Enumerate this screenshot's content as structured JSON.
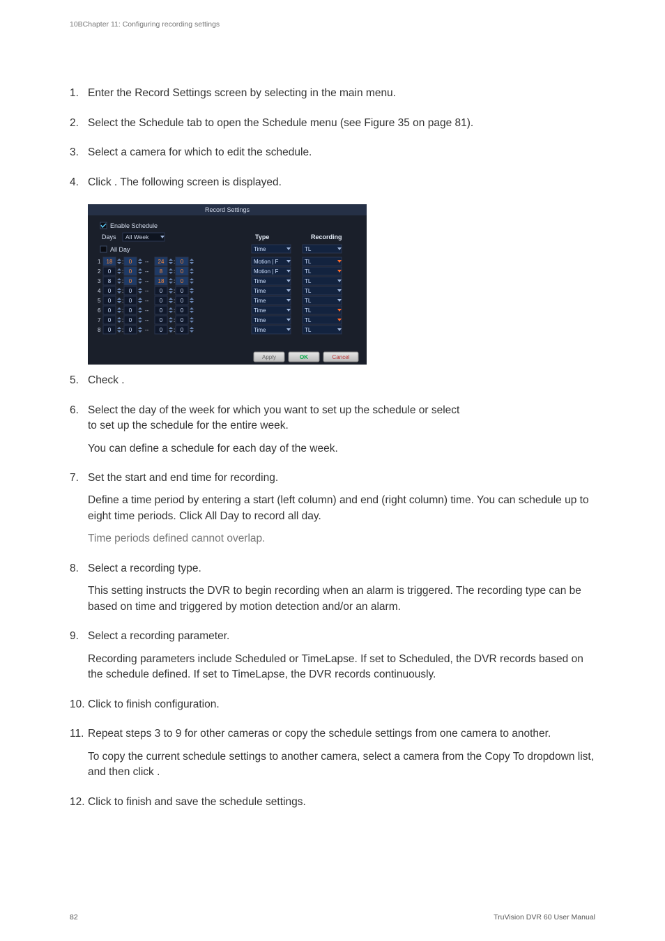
{
  "running_head": "10BChapter 11: Configuring recording settings",
  "steps": {
    "s1": "Enter the Record Settings screen by selecting            in the main menu.",
    "s2": "Select the Schedule tab to open the Schedule menu (see Figure 35 on page 81).",
    "s3": "Select a camera for which to edit the schedule.",
    "s4": "Click      . The following screen is displayed.",
    "s5": "Check                                     .",
    "s6a": "Select the day of the week for which you want to set up the schedule or select",
    "s6b": "                           to set up the schedule for the entire week.",
    "s6c": "You can define a schedule for each day of the week.",
    "s7a": "Set the start and end time for recording.",
    "s7b": "Define a time period by entering a start (left column) and end (right column) time. You can schedule up to eight time periods. Click All Day to record all day.",
    "s7note": "           Time periods defined cannot overlap.",
    "s8a": "Select a recording type.",
    "s8b": "This setting instructs the DVR to begin recording when an alarm is triggered. The recording type can be based on time and triggered by motion detection and/or an alarm.",
    "s9a": "Select a recording parameter.",
    "s9b": "Recording parameters include Scheduled or TimeLapse. If set to Scheduled, the DVR records based on the schedule defined. If set to TimeLapse, the DVR records continuously.",
    "s10": "Click       to finish configuration.",
    "s11a": "Repeat steps 3 to 9 for other cameras or copy the schedule settings from one camera to another.",
    "s11b": "To copy the current schedule settings to another camera, select a camera from the Copy To dropdown list, and then click         .",
    "s12": "Click       to finish and save the schedule settings."
  },
  "screenshot": {
    "title": "Record Settings",
    "enable_label": "Enable Schedule",
    "days_label": "Days",
    "days_value": "All Week",
    "allday_label": "All Day",
    "type_header": "Type",
    "recording_header": "Recording",
    "rows": [
      {
        "n": "1",
        "s1": "18",
        "s2": "0",
        "e1": "24",
        "e2": "0",
        "type": "Motion | F",
        "rec": "TL"
      },
      {
        "n": "2",
        "s1": "0",
        "s2": "0",
        "e1": "8",
        "e2": "0",
        "type": "Motion | F",
        "rec": "TL"
      },
      {
        "n": "3",
        "s1": "8",
        "s2": "0",
        "e1": "18",
        "e2": "0",
        "type": "Time",
        "rec": "TL"
      },
      {
        "n": "4",
        "s1": "0",
        "s2": "0",
        "e1": "0",
        "e2": "0",
        "type": "Time",
        "rec": "TL"
      },
      {
        "n": "5",
        "s1": "0",
        "s2": "0",
        "e1": "0",
        "e2": "0",
        "type": "Time",
        "rec": "TL"
      },
      {
        "n": "6",
        "s1": "0",
        "s2": "0",
        "e1": "0",
        "e2": "0",
        "type": "Time",
        "rec": "TL"
      },
      {
        "n": "7",
        "s1": "0",
        "s2": "0",
        "e1": "0",
        "e2": "0",
        "type": "Time",
        "rec": "TL"
      },
      {
        "n": "8",
        "s1": "0",
        "s2": "0",
        "e1": "0",
        "e2": "0",
        "type": "Time",
        "rec": "TL"
      }
    ],
    "btn_apply": "Apply",
    "btn_ok": "OK",
    "btn_cancel": "Cancel"
  },
  "footer": {
    "page": "82",
    "doc": "TruVision DVR 60 User Manual"
  }
}
